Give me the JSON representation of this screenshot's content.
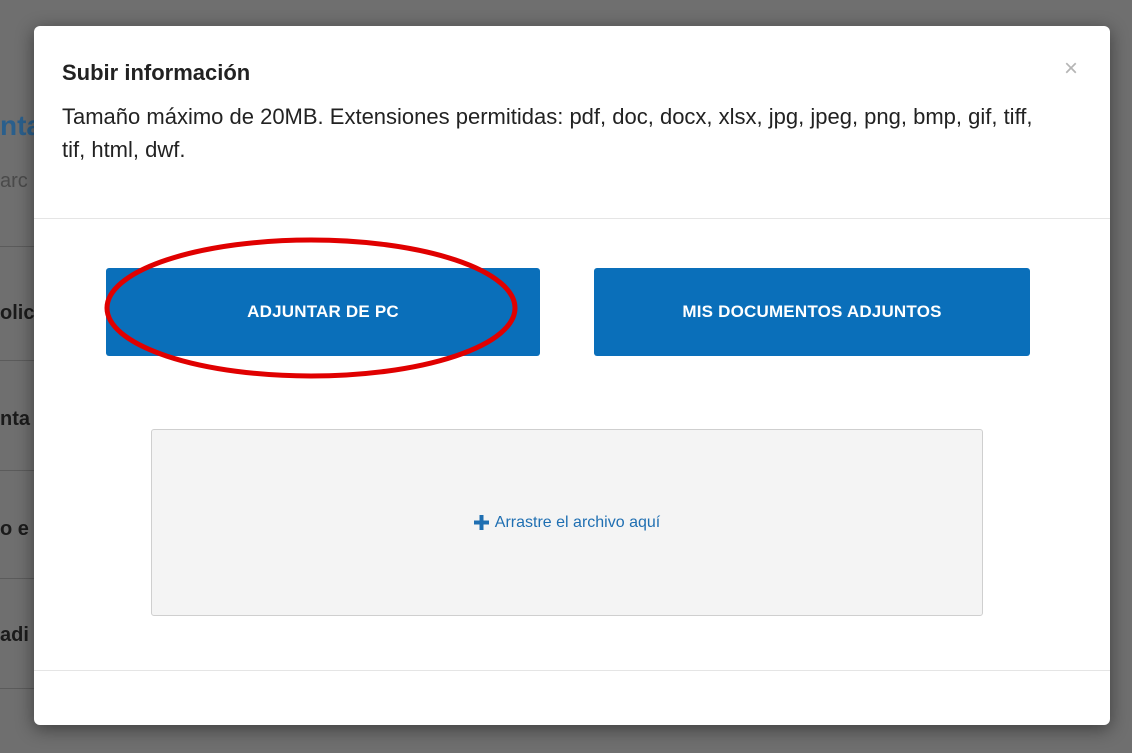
{
  "background": {
    "fragments": [
      "nta",
      "arc",
      "olic",
      "nta",
      "o e",
      "adi"
    ]
  },
  "modal": {
    "title": "Subir información",
    "description": "Tamaño máximo de 20MB. Extensiones permitidas: pdf, doc, docx, xlsx, jpg, jpeg, png, bmp, gif, tiff, tif, html, dwf.",
    "close_label": "×",
    "attach_pc_label": "ADJUNTAR DE PC",
    "my_documents_label": "MIS DOCUMENTOS ADJUNTOS",
    "dropzone_label": "Arrastre el archivo aquí",
    "dropzone_icon": "plus-icon"
  },
  "colors": {
    "primary_button": "#0a6fba",
    "highlight_ellipse": "#e00000",
    "link_blue": "#1f6fb2"
  }
}
